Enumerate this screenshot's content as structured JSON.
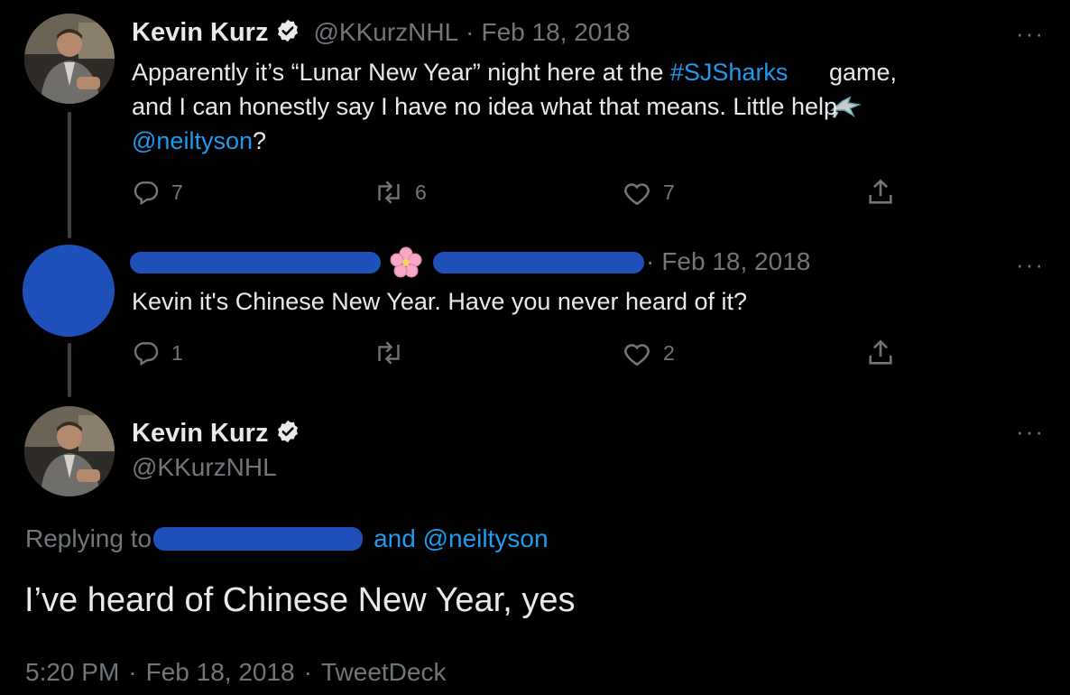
{
  "tweet1": {
    "name": "Kevin Kurz",
    "handle": "@KKurzNHL",
    "separator": "·",
    "date": "Feb 18, 2018",
    "text_part1": "Apparently it’s “Lunar New Year” night here at the ",
    "hashtag": "#SJSharks",
    "text_part2": " game,",
    "text_line2": "and I can honestly say I have no idea what that means. Little help",
    "mention": "@neiltyson",
    "text_end": "?",
    "replies": "7",
    "retweets": "6",
    "likes": "7"
  },
  "tweet2": {
    "separator": "·",
    "date": "Feb 18, 2018",
    "text": "Kevin it's Chinese New Year. Have you never heard of it?",
    "replies": "1",
    "retweets": "",
    "likes": "2"
  },
  "main_tweet": {
    "name": "Kevin Kurz",
    "handle": "@KKurzNHL",
    "replying_label": "Replying to",
    "replying_suffix": "and @neiltyson",
    "text": "I’ve heard of Chinese New Year, yes",
    "time": "5:20 PM",
    "separator": "·",
    "date": "Feb 18, 2018",
    "client": "TweetDeck"
  },
  "more_label": "···",
  "colors": {
    "background": "#000000",
    "text": "#e7e9ea",
    "muted": "#71767b",
    "link": "#1d9bf0",
    "redaction": "#1f4fb8"
  }
}
